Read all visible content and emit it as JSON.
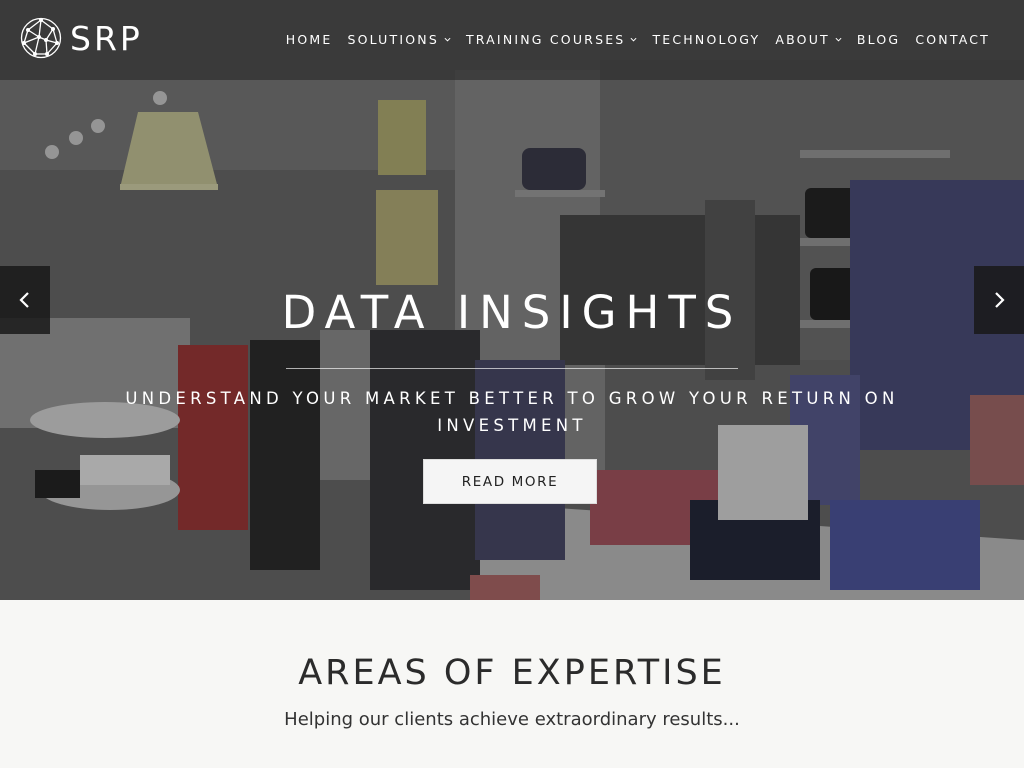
{
  "brand": {
    "name": "SRP"
  },
  "nav": {
    "items": [
      {
        "label": "HOME",
        "has_dropdown": false
      },
      {
        "label": "SOLUTIONS",
        "has_dropdown": true
      },
      {
        "label": "TRAINING COURSES",
        "has_dropdown": true
      },
      {
        "label": "TECHNOLOGY",
        "has_dropdown": false
      },
      {
        "label": "ABOUT",
        "has_dropdown": true
      },
      {
        "label": "BLOG",
        "has_dropdown": false
      },
      {
        "label": "CONTACT",
        "has_dropdown": false
      }
    ]
  },
  "hero": {
    "title": "DATA INSIGHTS",
    "subtitle": "UNDERSTAND YOUR MARKET BETTER TO GROW YOUR RETURN ON INVESTMENT",
    "button_label": "READ MORE",
    "prev_icon": "chevron-left-icon",
    "next_icon": "chevron-right-icon"
  },
  "expertise": {
    "title": "AREAS OF EXPERTISE",
    "subtitle": "Helping our clients achieve extraordinary results..."
  },
  "colors": {
    "header_bg": "#282828",
    "section_bg": "#f7f7f5",
    "text_dark": "#2b2b2b",
    "white": "#ffffff"
  }
}
